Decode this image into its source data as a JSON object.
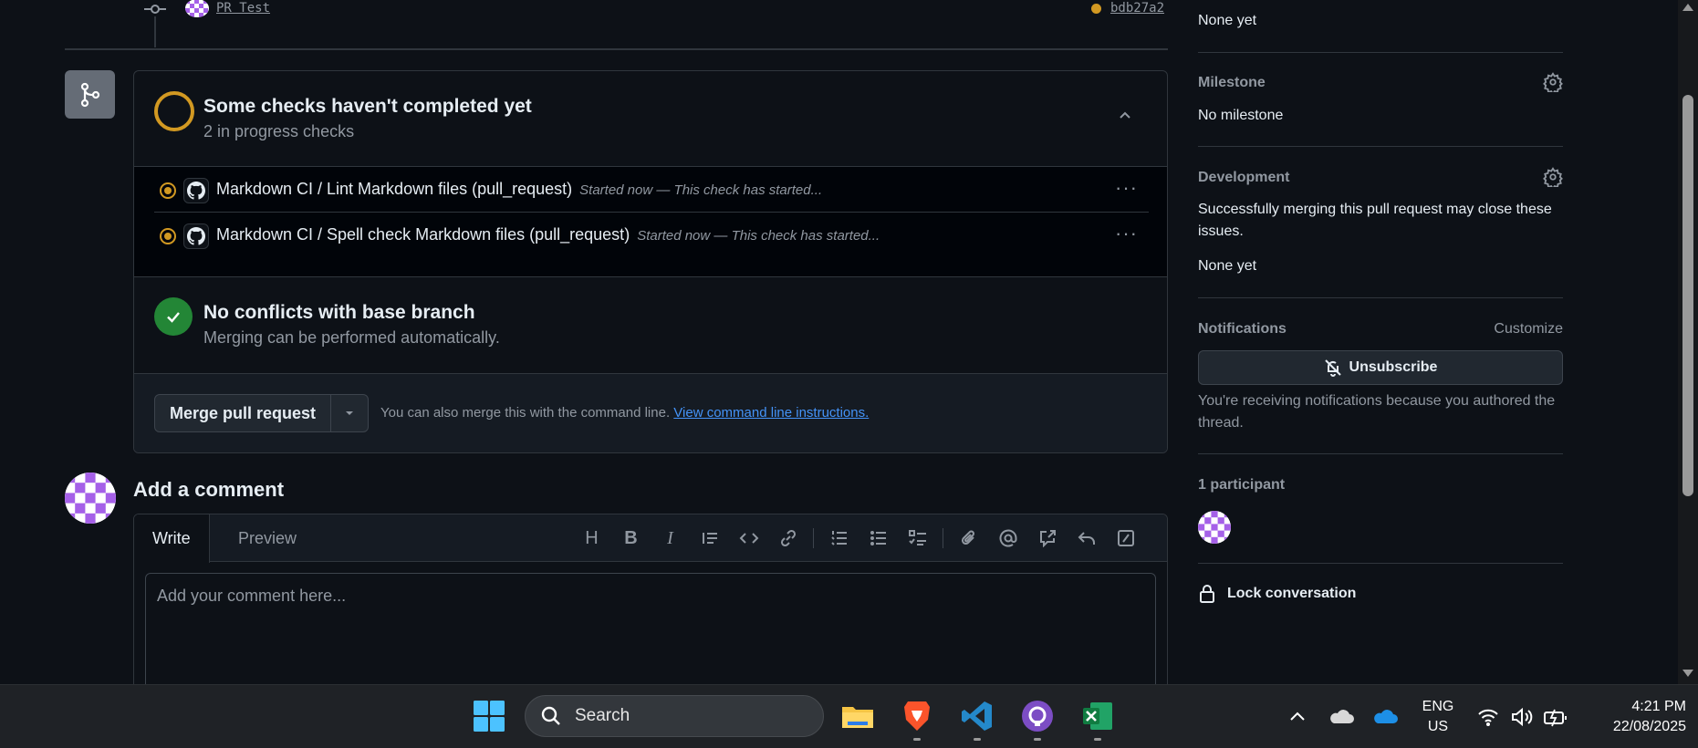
{
  "commit": {
    "message": "PR Test",
    "sha": "bdb27a2"
  },
  "checks": {
    "title": "Some checks haven't completed yet",
    "subtitle": "2 in progress checks",
    "items": [
      {
        "name": "Markdown CI / Lint Markdown files (pull_request)",
        "meta": "Started now — This check has started..."
      },
      {
        "name": "Markdown CI / Spell check Markdown files (pull_request)",
        "meta": "Started now — This check has started..."
      }
    ],
    "more_label": "···"
  },
  "conflicts": {
    "title": "No conflicts with base branch",
    "subtitle": "Merging can be performed automatically."
  },
  "merge": {
    "button_label": "Merge pull request",
    "hint_text": "You can also merge this with the command line.",
    "hint_link": "View command line instructions."
  },
  "comment": {
    "title": "Add a comment",
    "tab_write": "Write",
    "tab_preview": "Preview",
    "placeholder": "Add your comment here...",
    "toolbar": {
      "heading": "H",
      "bold": "B",
      "italic": "I"
    }
  },
  "sidebar": {
    "top_value": "None yet",
    "milestone_heading": "Milestone",
    "milestone_value": "No milestone",
    "development_heading": "Development",
    "development_text": "Successfully merging this pull request may close these issues.",
    "development_value": "None yet",
    "notifications_heading": "Notifications",
    "customize_label": "Customize",
    "unsubscribe_label": "Unsubscribe",
    "notifications_text": "You're receiving notifications because you authored the thread.",
    "participants_heading": "1 participant",
    "lock_label": "Lock conversation"
  },
  "taskbar": {
    "search_label": "Search",
    "lang_line1": "ENG",
    "lang_line2": "US",
    "time": "4:21 PM",
    "date": "22/08/2025"
  },
  "colors": {
    "pending": "#d29922",
    "success": "#238636",
    "link": "#4493f8",
    "avatar_purple": "#a560e8"
  }
}
